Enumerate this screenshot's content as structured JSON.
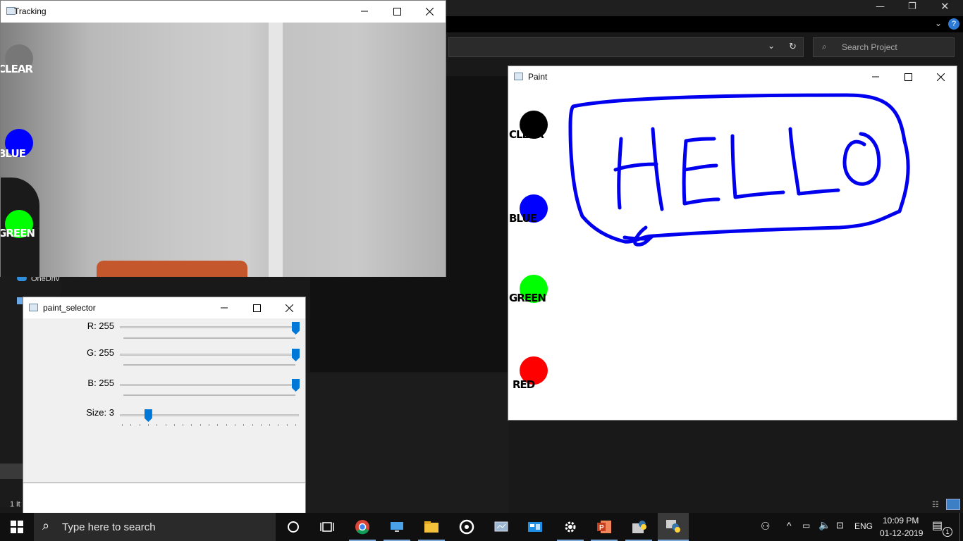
{
  "background_explorer": {
    "search_placeholder": "Search Project",
    "sidebar_onedrive": "OneDriv",
    "status_items": "1 it"
  },
  "tracking": {
    "title": "Tracking",
    "labels": {
      "clear": "CLEAR",
      "blue": "BLUE",
      "green": "GREEN"
    }
  },
  "paint_selector": {
    "title": "paint_selector",
    "sliders": [
      {
        "label": "R: 255",
        "value": 255,
        "max": 255
      },
      {
        "label": "G: 255",
        "value": 255,
        "max": 255
      },
      {
        "label": "B: 255",
        "value": 255,
        "max": 255
      },
      {
        "label": "Size: 3",
        "value": 3,
        "max": 20
      }
    ]
  },
  "paint": {
    "title": "Paint",
    "labels": {
      "clear": "CLEAR",
      "blue": "BLUE",
      "green": "GREEN",
      "red": "RED"
    },
    "drawing_text": "HELLO",
    "colors": {
      "clear": "#000000",
      "blue": "#0000ff",
      "green": "#00ff00",
      "red": "#ff0000",
      "stroke": "#0000ee"
    }
  },
  "taskbar": {
    "search_placeholder": "Type here to search",
    "language": "ENG",
    "time": "10:09 PM",
    "date": "01-12-2019",
    "notification_count": "1"
  }
}
